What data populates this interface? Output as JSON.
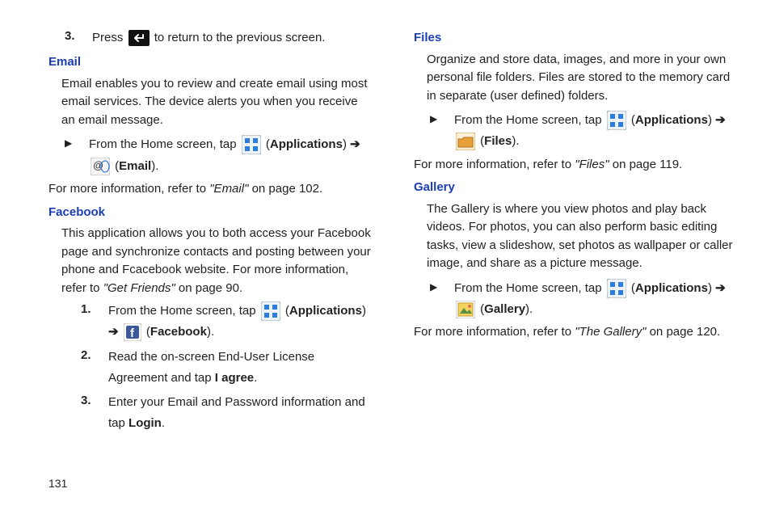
{
  "pageNumber": "131",
  "left": {
    "step3": {
      "num": "3.",
      "pre": "Press ",
      "post": " to return to the previous screen."
    },
    "email": {
      "heading": "Email",
      "intro": "Email enables you to review and create email using most email services. The device alerts you when you receive an email message.",
      "home_pre": "From the Home screen, tap ",
      "apps": "Applications",
      "email_lbl": "Email",
      "ref_pre": "For more information, refer to ",
      "ref_link": "\"Email\"",
      "ref_post": " on page 102."
    },
    "facebook": {
      "heading": "Facebook",
      "intro_pre": "This application allows you to both access your Facebook page and synchronize contacts and posting between your phone and Fcacebook website. For more information, refer to ",
      "intro_link": "\"Get Friends\"",
      "intro_post": " on page 90.",
      "s1": {
        "num": "1.",
        "pre": "From the Home screen, tap ",
        "apps": "Applications",
        "fb": "Facebook"
      },
      "s2": {
        "num": "2.",
        "pre": "Read the on-screen End-User License Agreement and tap ",
        "bold": "I agree",
        "post": "."
      },
      "s3": {
        "num": "3.",
        "pre": "Enter your Email and Password information and tap ",
        "bold": "Login",
        "post": "."
      }
    }
  },
  "right": {
    "files": {
      "heading": "Files",
      "intro": "Organize and store data, images, and more in your own personal file folders. Files are stored to the memory card in separate (user defined) folders.",
      "home_pre": "From the Home screen, tap ",
      "apps": "Applications",
      "files_lbl": "Files",
      "ref_pre": "For more information, refer to ",
      "ref_link": "\"Files\"",
      "ref_post": " on page 119."
    },
    "gallery": {
      "heading": "Gallery",
      "intro": "The Gallery is where you view photos and play back videos. For photos, you can also perform basic editing tasks, view a slideshow, set photos as wallpaper or caller image, and share as a picture message.",
      "home_pre": "From the Home screen, tap ",
      "apps": "Applications",
      "gallery_lbl": "Gallery",
      "ref_pre": "For more information, refer to ",
      "ref_link": "\"The Gallery\"",
      "ref_post": " on page 120."
    }
  }
}
